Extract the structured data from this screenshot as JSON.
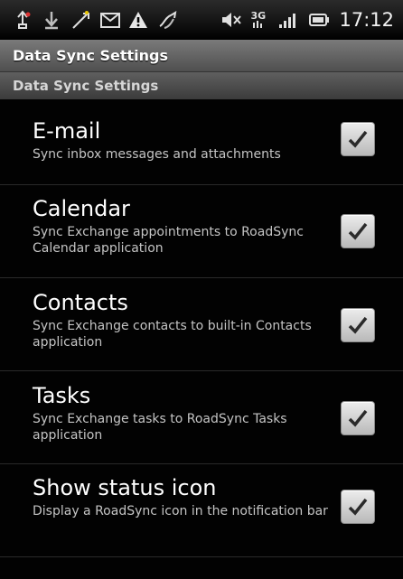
{
  "status_bar": {
    "icons": [
      "usb-debug-icon",
      "download-icon",
      "signal-strength-icon",
      "mail-icon",
      "warning-icon",
      "sync-icon"
    ],
    "right_icons": [
      "mute-icon",
      "3g-icon",
      "signal-bars-icon",
      "battery-icon"
    ],
    "network_label": "3G",
    "time": "17:12"
  },
  "title_bar": {
    "title": "Data Sync Settings"
  },
  "section": {
    "header": "Data Sync Settings"
  },
  "settings": [
    {
      "title": "E-mail",
      "summary": "Sync inbox messages and attachments",
      "checked": true
    },
    {
      "title": "Calendar",
      "summary": "Sync Exchange appointments to RoadSync Calendar application",
      "checked": true
    },
    {
      "title": "Contacts",
      "summary": "Sync Exchange contacts to built-in Contacts application",
      "checked": true
    },
    {
      "title": "Tasks",
      "summary": "Sync Exchange tasks to RoadSync Tasks application",
      "checked": true
    },
    {
      "title": "Show status icon",
      "summary": "Display a RoadSync icon in the notification bar",
      "checked": true
    }
  ],
  "colors": {
    "check": "#2a2a2a",
    "checkbox_bg": "#d6d6d6"
  }
}
